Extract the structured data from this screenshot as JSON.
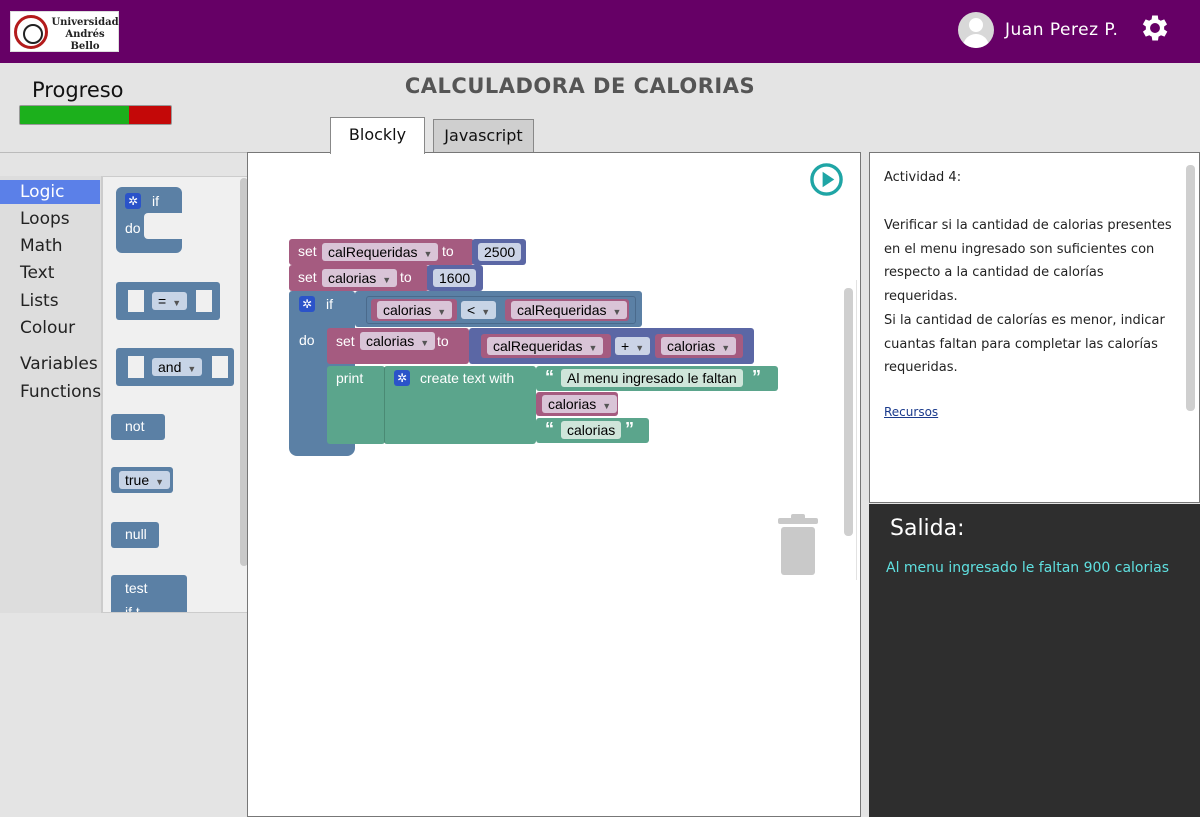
{
  "header": {
    "logo_text": "Universidad Andrés Bello",
    "user_name": "Juan Perez P.",
    "colors": {
      "brand": "#660066"
    }
  },
  "progress": {
    "label": "Progreso",
    "value": 0.72
  },
  "page_title": "CALCULADORA DE CALORIAS",
  "tabs": [
    {
      "label": "Blockly",
      "active": true
    },
    {
      "label": "Javascript",
      "active": false
    }
  ],
  "toolbox": {
    "categories": [
      "Logic",
      "Loops",
      "Math",
      "Text",
      "Lists",
      "Colour"
    ],
    "extra_categories": [
      "Variables",
      "Functions"
    ],
    "selected": "Logic"
  },
  "flyout": {
    "if_label": "if",
    "do_label": "do",
    "compare_op": "=",
    "and_op": "and",
    "not_label": "not",
    "true_label": "true",
    "null_label": "null",
    "test_label": "test",
    "test_label2": "if t..."
  },
  "program": {
    "set1": {
      "kw": "set",
      "var": "calRequeridas",
      "to": "to",
      "value": "2500"
    },
    "set2": {
      "kw": "set",
      "var": "calorias",
      "to": "to",
      "value": "1600"
    },
    "if_block": {
      "if_kw": "if",
      "do_kw": "do",
      "left": "calorias",
      "op": "<",
      "right": "calRequeridas"
    },
    "set3": {
      "kw": "set",
      "var": "calorias",
      "to": "to",
      "left": "calRequeridas",
      "op": "+",
      "right": "calorias"
    },
    "print": {
      "kw": "print",
      "create": "create text with",
      "item1": "Al menu ingresado le faltan",
      "item2": "calorias",
      "item3": "calorias",
      "quote_open": "“",
      "quote_close": "”"
    }
  },
  "activity": {
    "title": "Actividad 4:",
    "p1": "Verificar si la cantidad de calorias presentes en el menu ingresado son suficientes con respecto a la cantidad de calorías requeridas.",
    "p2": "Si la cantidad de calorías es menor, indicar cuantas faltan para completar las calorías requeridas.",
    "link": "Recursos"
  },
  "output": {
    "title": "Salida:",
    "text": "Al menu ingresado le faltan 900 calorias"
  },
  "icons": [
    "gear-icon",
    "user-avatar-icon",
    "play-icon",
    "trash-icon"
  ]
}
